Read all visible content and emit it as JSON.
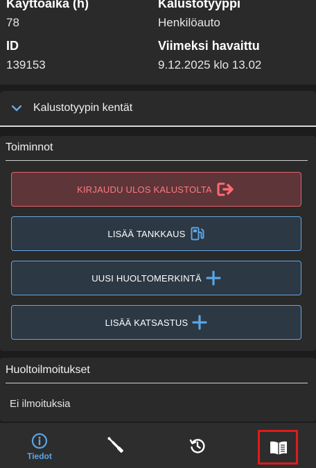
{
  "info": {
    "cells": [
      {
        "label": "Käyttöaika (h)",
        "value": "78"
      },
      {
        "label": "Kalustotyyppi",
        "value": "Henkilöauto"
      },
      {
        "label": "ID",
        "value": "139153"
      },
      {
        "label": "Viimeksi havaittu",
        "value": "9.12.2025 klo 13.02"
      }
    ]
  },
  "expander": {
    "label": "Kalustotyypin kentät",
    "icon": "chevron-down-icon"
  },
  "actions": {
    "title": "Toiminnot",
    "buttons": [
      {
        "label": "KIRJAUDU ULOS KALUSTOLTA",
        "icon": "logout-icon",
        "style": "danger"
      },
      {
        "label": "LISÄÄ TANKKAUS",
        "icon": "fuel-pump-icon",
        "style": "primary"
      },
      {
        "label": "UUSI HUOLTOMERKINTÄ",
        "icon": "plus-icon",
        "style": "primary"
      },
      {
        "label": "LISÄÄ KATSASTUS",
        "icon": "plus-icon",
        "style": "primary"
      }
    ]
  },
  "notices": {
    "title": "Huoltoilmoitukset",
    "empty_text": "Ei ilmoituksia"
  },
  "nav": {
    "items": [
      {
        "label": "Tiedot",
        "icon": "info-icon",
        "active": true
      },
      {
        "label": "",
        "icon": "wrench-icon",
        "active": false
      },
      {
        "label": "",
        "icon": "history-icon",
        "active": false
      },
      {
        "label": "",
        "icon": "manual-book-icon",
        "active": false,
        "highlighted": true
      }
    ]
  },
  "colors": {
    "accent": "#5aa6e6",
    "danger": "#e5636b",
    "highlight": "#e11a1a"
  }
}
